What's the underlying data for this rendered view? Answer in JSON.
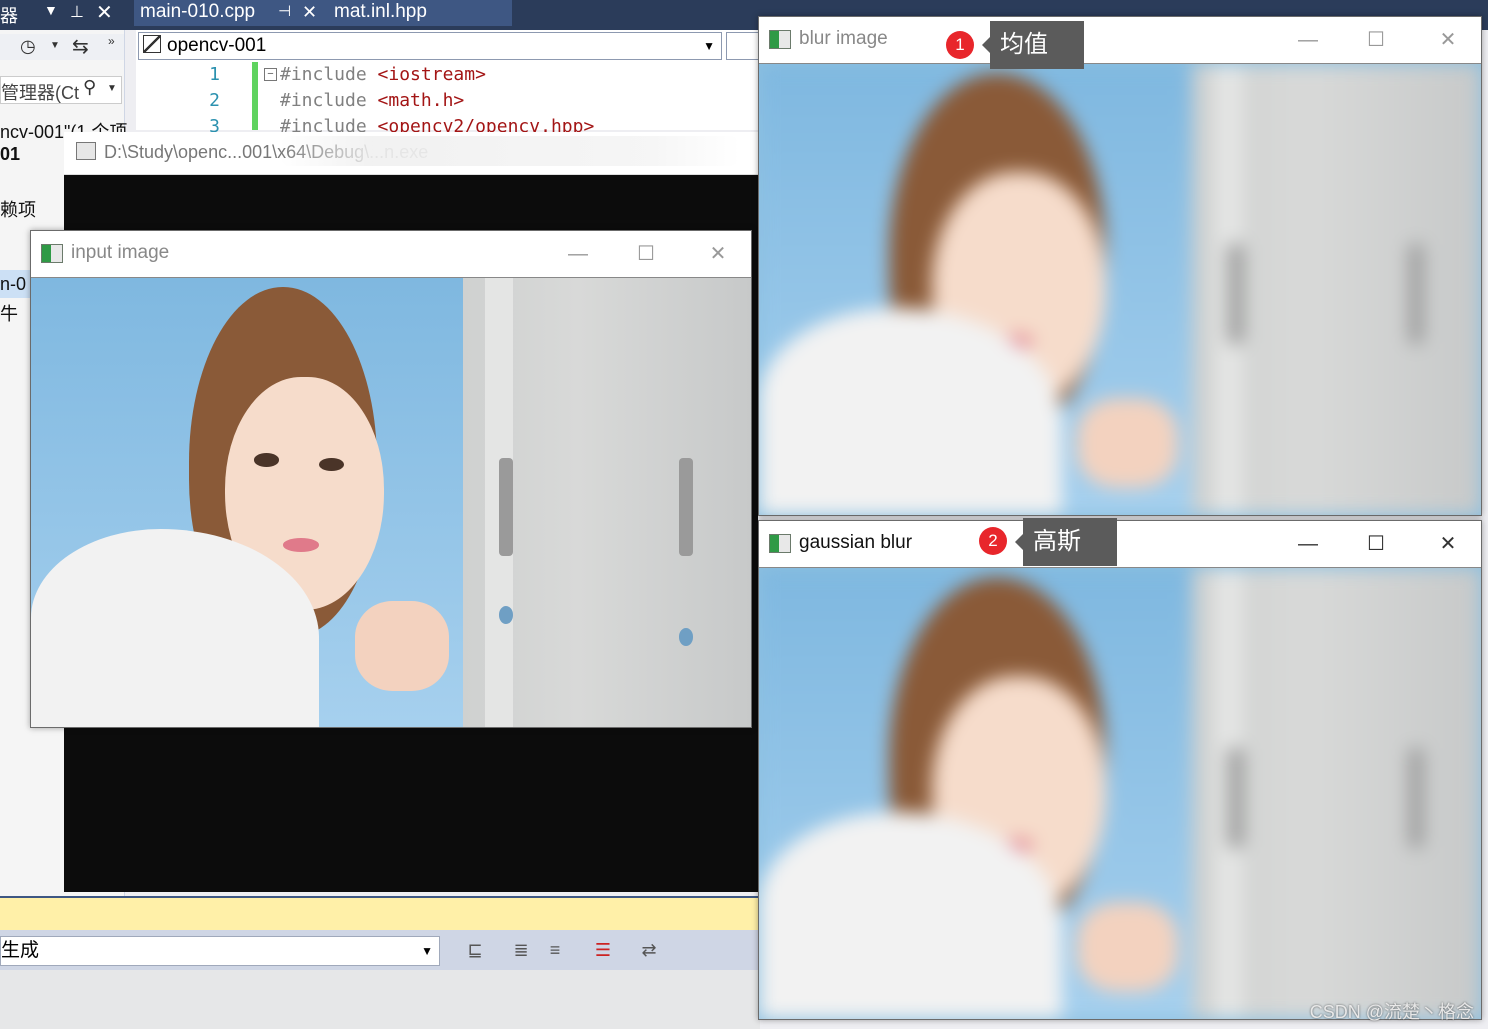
{
  "ide": {
    "tabs": [
      {
        "label": "main-010.cpp",
        "pin": "⊣",
        "close": "✕"
      },
      {
        "label": "mat.inl.hpp"
      }
    ],
    "left_strip_title": "器",
    "project_combo": "opencv-001",
    "solution_panel": {
      "search_text": "管理器(Ct",
      "solution_line": "ncv-001\"(1 个项",
      "project_line": "01",
      "deps": "赖项",
      "src_line": "n-0",
      "file_line": "牛"
    },
    "code_lines": [
      {
        "num": "1",
        "text": "#include ",
        "str": "<iostream>"
      },
      {
        "num": "2",
        "text": "#include ",
        "str": "<math.h>"
      },
      {
        "num": "3",
        "text": "#include ",
        "str": "<opencv2/opencv.hpp>"
      }
    ],
    "console_title": "D:\\Study\\openc...001\\x64\\Debug\\...n.exe",
    "bottom": {
      "generate_label": "生成"
    }
  },
  "windows": {
    "input": {
      "title": "input image",
      "min": "—",
      "max": "☐",
      "close": "✕"
    },
    "blur": {
      "title": "blur image",
      "min": "—",
      "max": "☐",
      "close": "✕"
    },
    "gaussian": {
      "title": "gaussian blur",
      "min": "—",
      "max": "☐",
      "close": "✕"
    }
  },
  "annotations": [
    {
      "num": "1",
      "label": "均值"
    },
    {
      "num": "2",
      "label": "高斯"
    }
  ],
  "watermark": "CSDN @流楚丶格念"
}
